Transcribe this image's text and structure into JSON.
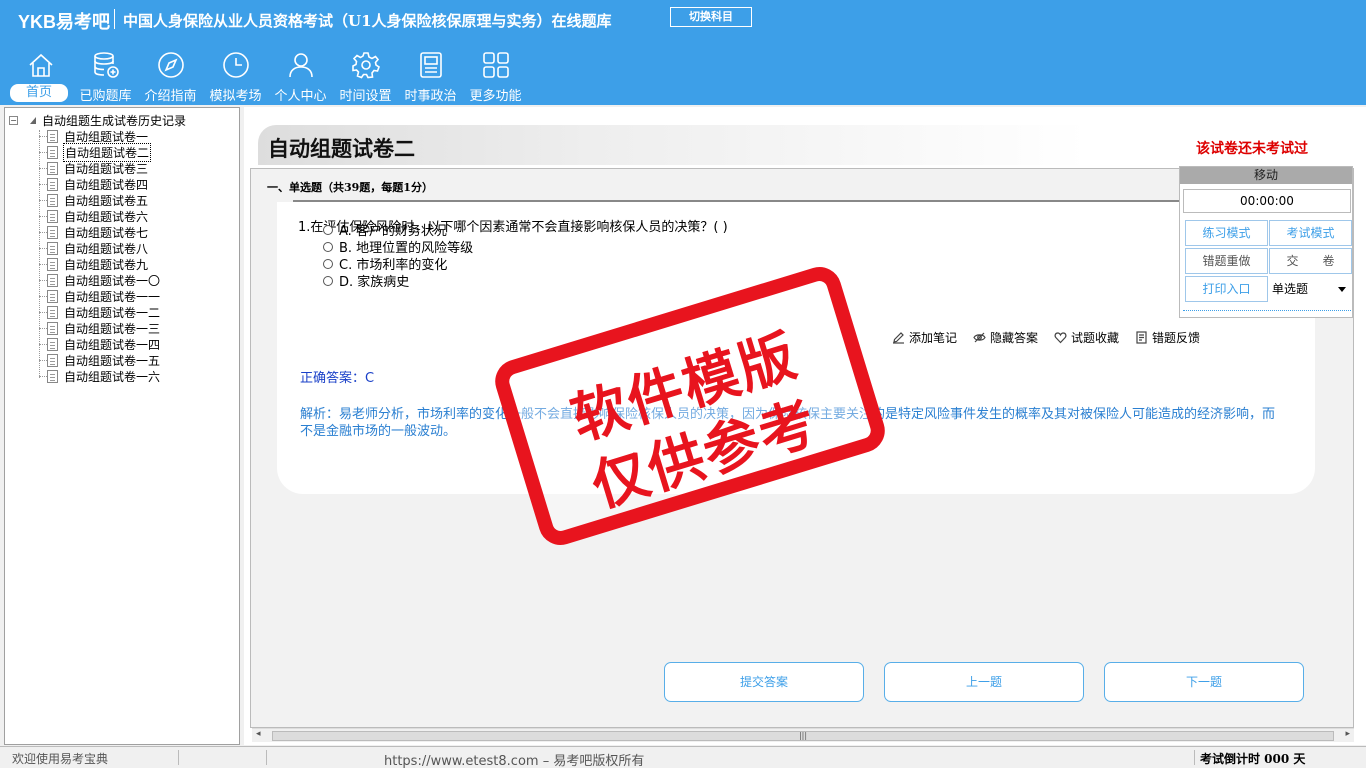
{
  "app": {
    "logo": "YKB易考吧",
    "title": "中国人身保险从业人员资格考试（U1人身保险核保原理与实务）在线题库",
    "switch_label": "切换科目"
  },
  "nav": [
    {
      "label": "首页",
      "icon": "home-icon",
      "active": true
    },
    {
      "label": "已购题库",
      "icon": "database-icon"
    },
    {
      "label": "介绍指南",
      "icon": "compass-icon"
    },
    {
      "label": "模拟考场",
      "icon": "clock-icon"
    },
    {
      "label": "个人中心",
      "icon": "user-icon"
    },
    {
      "label": "时间设置",
      "icon": "gear-icon"
    },
    {
      "label": "时事政治",
      "icon": "news-icon"
    },
    {
      "label": "更多功能",
      "icon": "grid-icon"
    }
  ],
  "tree": {
    "root": "自动组题生成试卷历史记录",
    "items": [
      "自动组题试卷一",
      "自动组题试卷二",
      "自动组题试卷三",
      "自动组题试卷四",
      "自动组题试卷五",
      "自动组题试卷六",
      "自动组题试卷七",
      "自动组题试卷八",
      "自动组题试卷九",
      "自动组题试卷一〇",
      "自动组题试卷一一",
      "自动组题试卷一二",
      "自动组题试卷一三",
      "自动组题试卷一四",
      "自动组题试卷一五",
      "自动组题试卷一六"
    ],
    "selected_index": 1
  },
  "paper": {
    "title": "自动组题试卷二",
    "status": "该试卷还未考试过",
    "section": "一、单选题（共39题，每题1分）"
  },
  "question": {
    "text": "1.在评估保险风险时，以下哪个因素通常不会直接影响核保人员的决策？( )",
    "options": [
      "A. 客户的财务状况",
      "B. 地理位置的风险等级",
      "C. 市场利率的变化",
      "D. 家族病史"
    ],
    "answer": "正确答案：C",
    "analysis": "解析：易老师分析，市场利率的变化一般不会直接影响保险核保人员的决策，因为保险核保主要关注的是特定风险事件发生的概率及其对被保险人可能造成的经济影响，而不是金融市场的一般波动。"
  },
  "actions": [
    {
      "label": "添加笔记",
      "icon": "pencil-icon"
    },
    {
      "label": "隐藏答案",
      "icon": "eye-icon"
    },
    {
      "label": "试题收藏",
      "icon": "heart-icon"
    },
    {
      "label": "错题反馈",
      "icon": "feedback-icon"
    }
  ],
  "buttons": {
    "submit": "提交答案",
    "prev": "上一题",
    "next": "下一题"
  },
  "control": {
    "title": "移动",
    "timer": "00:00:00",
    "practice": "练习模式",
    "exam": "考试模式",
    "redo": "错题重做",
    "hand_in": "交　　卷",
    "print": "打印入口",
    "type_select": "单选题"
  },
  "watermark": {
    "line1": "软件模版",
    "line2": "仅供参考"
  },
  "status": {
    "welcome": "欢迎使用易考宝典",
    "url": "https://www.etest8.com – 易考吧版权所有",
    "countdown": "考试倒计时 000 天"
  },
  "colors": {
    "header": "#3d9fe8",
    "stamp": "#e8141e",
    "answer": "#1a40c8",
    "analysis": "#2a7fd1",
    "status_red": "#dd0000"
  }
}
